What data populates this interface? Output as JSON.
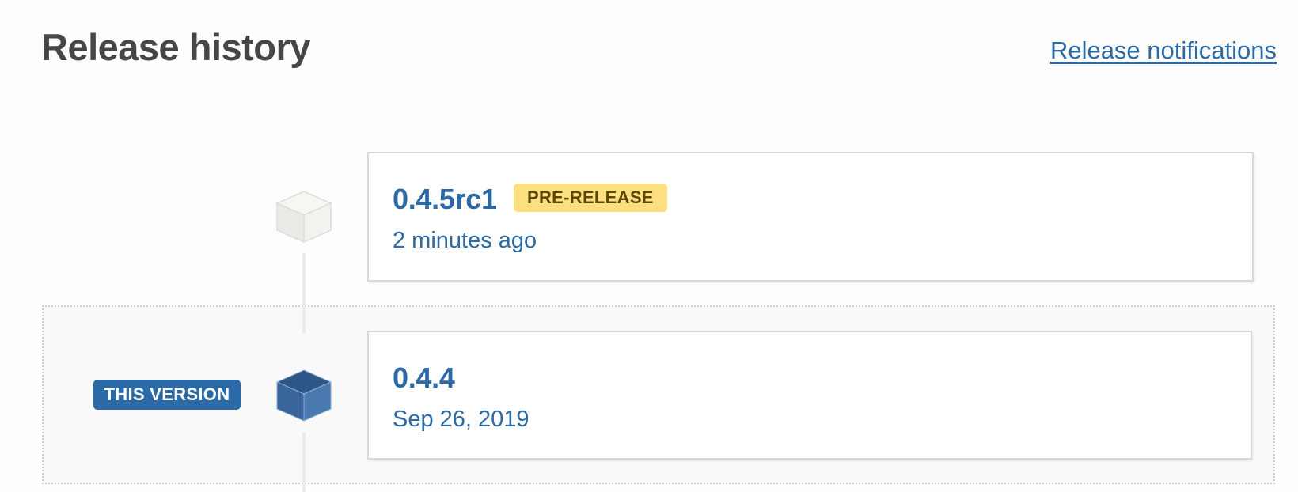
{
  "header": {
    "title": "Release history",
    "notifications_link": "Release notifications"
  },
  "releases": [
    {
      "version": "0.4.5rc1",
      "badge": "PRE-RELEASE",
      "date": "2 minutes ago",
      "current": false
    },
    {
      "version": "0.4.4",
      "date": "Sep 26, 2019",
      "current": true,
      "current_label": "THIS VERSION"
    }
  ],
  "colors": {
    "link": "#2b6aa6",
    "prerelease_badge": "#fddf7f",
    "this_version_badge": "#2b6aa6",
    "cube_current": "#3d6b9f",
    "cube_other": "#f0efec"
  },
  "icons": {
    "release": "package-cube-icon"
  }
}
